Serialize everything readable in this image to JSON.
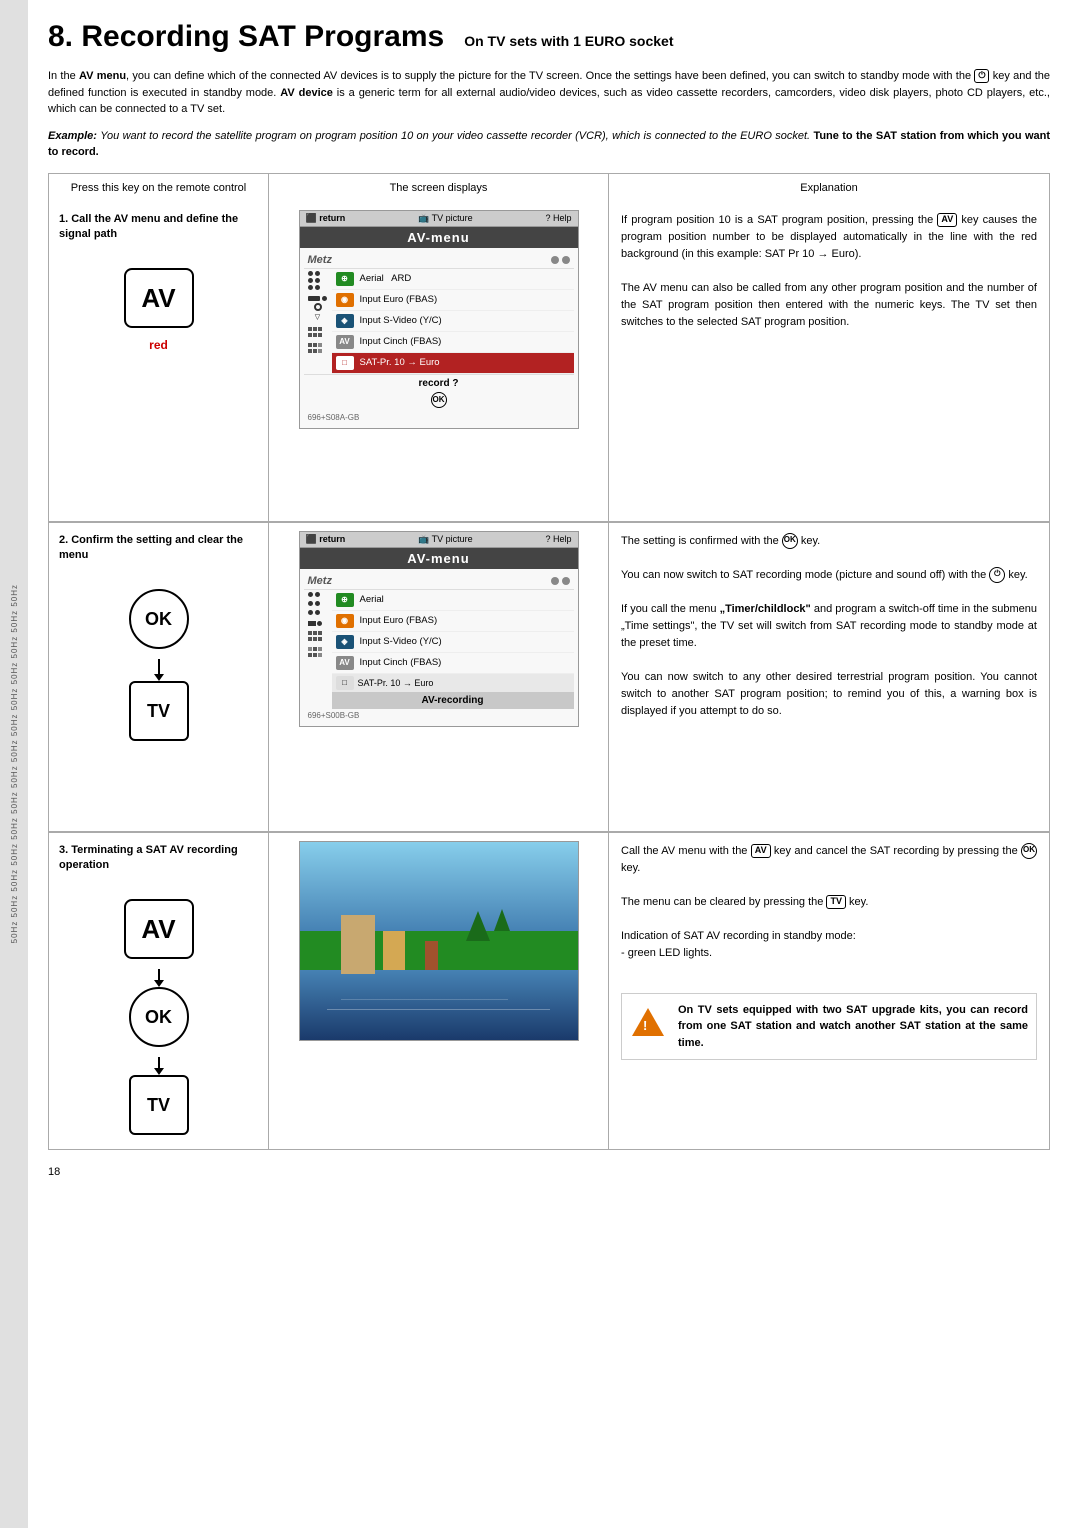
{
  "header": {
    "title": "8. Recording SAT Programs",
    "subtitle": "On TV sets with 1 EURO socket"
  },
  "side_stripe_texts": [
    "50Hz",
    "50Hz",
    "50Hz",
    "50Hz",
    "50Hz",
    "50Hz"
  ],
  "intro": {
    "text": "In the AV menu, you can define which of the connected AV devices is to supply the picture for the TV screen. Once the settings have been defined, you can switch to standby mode with the key and the defined function is executed in standby mode. AV device is a generic term for all external audio/video devices, such as video cassette recorders, camcorders, video disk players, photo CD players, etc., which can be connected to a TV set."
  },
  "example": {
    "prefix": "Example:",
    "text": "You want to record the satellite program on program position 10 on your video cassette recorder (VCR), which is connected to the EURO socket.",
    "bold_text": "Tune to the SAT station from which you want to record."
  },
  "table": {
    "headers": {
      "col1": "Press this key on the remote control",
      "col2": "The screen displays",
      "col3": "Explanation"
    },
    "rows": [
      {
        "step_label": "1. Call the AV menu and define the signal path",
        "keys": [
          "AV",
          "red"
        ],
        "screen_title": "AV-menu",
        "screen_items": [
          {
            "icon": "⊕",
            "icon_color": "green",
            "text": "Aerial  ARD"
          },
          {
            "icon": "◉",
            "icon_color": "orange",
            "text": "Input Euro (FBAS)"
          },
          {
            "icon": "◈",
            "icon_color": "blue",
            "text": "Input S-Video (Y/C)"
          },
          {
            "icon": "AV",
            "icon_color": "grey",
            "text": "Input Cinch (FBAS)"
          },
          {
            "icon": "□",
            "icon_color": "white",
            "text": "SAT-Pr. 10 → Euro",
            "highlight": true
          }
        ],
        "screen_footer": "record ?",
        "screen_code": "696+S08A-GB",
        "explanation": "If program position 10 is a SAT program position, pressing the AV key causes the program position number to be displayed automatically in the line with the red background (in this example: SAT Pr 10 → Euro).\n\nThe AV menu can also be called from any other program position and the number of the SAT program position then entered with the numeric keys. The TV set then switches to the selected SAT program position."
      },
      {
        "step_label": "2. Confirm the setting and clear the menu",
        "keys": [
          "OK",
          "TV"
        ],
        "screen_title": "AV-menu",
        "screen_items": [
          {
            "icon": "⊕",
            "icon_color": "green",
            "text": "Aerial"
          },
          {
            "icon": "◉",
            "icon_color": "orange",
            "text": "Input Euro (FBAS)"
          },
          {
            "icon": "◈",
            "icon_color": "blue",
            "text": "Input S-Video (Y/C)"
          },
          {
            "icon": "AV",
            "icon_color": "grey",
            "text": "Input Cinch (FBAS)"
          },
          {
            "icon": "□",
            "icon_color": "white",
            "text": "SAT-Pr. 10 → Euro",
            "highlight": false
          }
        ],
        "screen_footer": "AV-recording",
        "screen_code": "696+S00B-GB",
        "explanation": "The setting is confirmed with the OK key.\n\nYou can now switch to SAT recording mode (picture and sound off) with the key.\n\nIf you call the menu \"Timer/childlock\" and program a switch-off time in the submenu \"Time settings\", the TV set will switch from SAT recording mode to standby mode at the preset time.\n\nYou can now switch to any other desired terrestrial program position. You cannot switch to another SAT program position; to remind you of this, a warning box is displayed if you attempt to do so."
      },
      {
        "step_label": "3. Terminating a SAT AV recording operation",
        "keys": [
          "AV",
          "OK",
          "TV"
        ],
        "explanation": "Call the AV menu with the AV key and cancel the SAT recording by pressing the OK key.\n\nThe menu can be cleared by pressing the TV key.\n\nIndication of SAT AV recording in standby mode:\n- green LED lights."
      }
    ]
  },
  "warning": {
    "text": "On TV sets equipped with two SAT upgrade kits, you can record from one SAT station and watch another SAT station at the same time."
  },
  "page_number": "18",
  "icons": {
    "av_key": "AV",
    "ok_key": "OK",
    "tv_key": "TV",
    "return_label": "return",
    "tv_picture_label": "TV picture",
    "help_label": "Help"
  }
}
